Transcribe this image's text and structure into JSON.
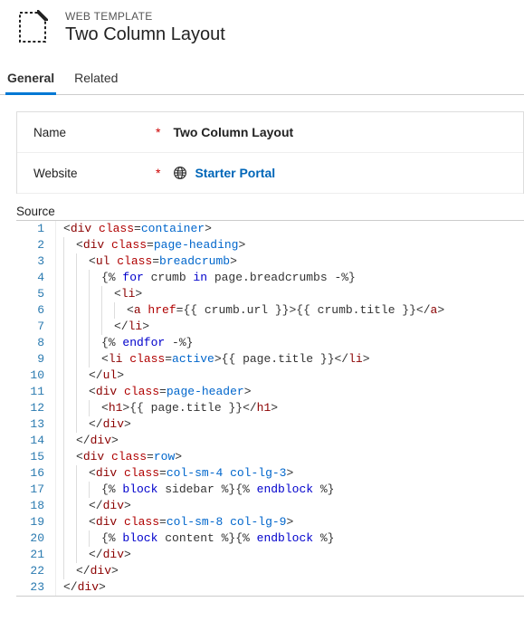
{
  "header": {
    "eyebrow": "WEB TEMPLATE",
    "title": "Two Column Layout"
  },
  "tabs": {
    "general": "General",
    "related": "Related"
  },
  "form": {
    "name_label": "Name",
    "name_value": "Two Column Layout",
    "website_label": "Website",
    "website_value": "Starter Portal",
    "source_label": "Source",
    "required_mark": "*"
  },
  "code": {
    "lines": [
      {
        "n": 1,
        "indent": 0,
        "tokens": [
          [
            "punc",
            "<"
          ],
          [
            "tag",
            "div "
          ],
          [
            "attr",
            "class"
          ],
          [
            "punc",
            "="
          ],
          [
            "val",
            "container"
          ],
          [
            "punc",
            ">"
          ]
        ]
      },
      {
        "n": 2,
        "indent": 1,
        "tokens": [
          [
            "punc",
            "<"
          ],
          [
            "tag",
            "div "
          ],
          [
            "attr",
            "class"
          ],
          [
            "punc",
            "="
          ],
          [
            "val",
            "page-heading"
          ],
          [
            "punc",
            ">"
          ]
        ]
      },
      {
        "n": 3,
        "indent": 2,
        "tokens": [
          [
            "punc",
            "<"
          ],
          [
            "tag",
            "ul "
          ],
          [
            "attr",
            "class"
          ],
          [
            "punc",
            "="
          ],
          [
            "val",
            "breadcrumb"
          ],
          [
            "punc",
            ">"
          ]
        ]
      },
      {
        "n": 4,
        "indent": 3,
        "tokens": [
          [
            "delim",
            "{% "
          ],
          [
            "kw",
            "for"
          ],
          [
            "text",
            " crumb "
          ],
          [
            "kw",
            "in"
          ],
          [
            "text",
            " page.breadcrumbs -%}"
          ]
        ]
      },
      {
        "n": 5,
        "indent": 4,
        "tokens": [
          [
            "punc",
            "<"
          ],
          [
            "tag",
            "li"
          ],
          [
            "punc",
            ">"
          ]
        ]
      },
      {
        "n": 6,
        "indent": 5,
        "tokens": [
          [
            "punc",
            "<"
          ],
          [
            "tag",
            "a "
          ],
          [
            "attr",
            "href"
          ],
          [
            "punc",
            "="
          ],
          [
            "text",
            "{{ crumb.url }}>{{ crumb.title }}"
          ],
          [
            "punc",
            "</"
          ],
          [
            "tag",
            "a"
          ],
          [
            "punc",
            ">"
          ]
        ]
      },
      {
        "n": 7,
        "indent": 4,
        "tokens": [
          [
            "punc",
            "</"
          ],
          [
            "tag",
            "li"
          ],
          [
            "punc",
            ">"
          ]
        ]
      },
      {
        "n": 8,
        "indent": 3,
        "tokens": [
          [
            "delim",
            "{% "
          ],
          [
            "kw",
            "endfor"
          ],
          [
            "text",
            " -%}"
          ]
        ]
      },
      {
        "n": 9,
        "indent": 3,
        "tokens": [
          [
            "punc",
            "<"
          ],
          [
            "tag",
            "li "
          ],
          [
            "attr",
            "class"
          ],
          [
            "punc",
            "="
          ],
          [
            "val",
            "active"
          ],
          [
            "punc",
            ">"
          ],
          [
            "text",
            "{{ page.title }}"
          ],
          [
            "punc",
            "</"
          ],
          [
            "tag",
            "li"
          ],
          [
            "punc",
            ">"
          ]
        ]
      },
      {
        "n": 10,
        "indent": 2,
        "tokens": [
          [
            "punc",
            "</"
          ],
          [
            "tag",
            "ul"
          ],
          [
            "punc",
            ">"
          ]
        ]
      },
      {
        "n": 11,
        "indent": 2,
        "tokens": [
          [
            "punc",
            "<"
          ],
          [
            "tag",
            "div "
          ],
          [
            "attr",
            "class"
          ],
          [
            "punc",
            "="
          ],
          [
            "val",
            "page-header"
          ],
          [
            "punc",
            ">"
          ]
        ]
      },
      {
        "n": 12,
        "indent": 3,
        "tokens": [
          [
            "punc",
            "<"
          ],
          [
            "tag",
            "h1"
          ],
          [
            "punc",
            ">"
          ],
          [
            "text",
            "{{ page.title }}"
          ],
          [
            "punc",
            "</"
          ],
          [
            "tag",
            "h1"
          ],
          [
            "punc",
            ">"
          ]
        ]
      },
      {
        "n": 13,
        "indent": 2,
        "tokens": [
          [
            "punc",
            "</"
          ],
          [
            "tag",
            "div"
          ],
          [
            "punc",
            ">"
          ]
        ]
      },
      {
        "n": 14,
        "indent": 1,
        "tokens": [
          [
            "punc",
            "</"
          ],
          [
            "tag",
            "div"
          ],
          [
            "punc",
            ">"
          ]
        ]
      },
      {
        "n": 15,
        "indent": 1,
        "tokens": [
          [
            "punc",
            "<"
          ],
          [
            "tag",
            "div "
          ],
          [
            "attr",
            "class"
          ],
          [
            "punc",
            "="
          ],
          [
            "val",
            "row"
          ],
          [
            "punc",
            ">"
          ]
        ]
      },
      {
        "n": 16,
        "indent": 2,
        "tokens": [
          [
            "punc",
            "<"
          ],
          [
            "tag",
            "div "
          ],
          [
            "attr",
            "class"
          ],
          [
            "punc",
            "="
          ],
          [
            "val",
            "col-sm-4 col-lg-3"
          ],
          [
            "punc",
            ">"
          ]
        ]
      },
      {
        "n": 17,
        "indent": 3,
        "tokens": [
          [
            "delim",
            "{% "
          ],
          [
            "kw",
            "block"
          ],
          [
            "text",
            " sidebar %}{% "
          ],
          [
            "kw",
            "endblock"
          ],
          [
            "text",
            " %}"
          ]
        ]
      },
      {
        "n": 18,
        "indent": 2,
        "tokens": [
          [
            "punc",
            "</"
          ],
          [
            "tag",
            "div"
          ],
          [
            "punc",
            ">"
          ]
        ]
      },
      {
        "n": 19,
        "indent": 2,
        "tokens": [
          [
            "punc",
            "<"
          ],
          [
            "tag",
            "div "
          ],
          [
            "attr",
            "class"
          ],
          [
            "punc",
            "="
          ],
          [
            "val",
            "col-sm-8 col-lg-9"
          ],
          [
            "punc",
            ">"
          ]
        ]
      },
      {
        "n": 20,
        "indent": 3,
        "tokens": [
          [
            "delim",
            "{% "
          ],
          [
            "kw",
            "block"
          ],
          [
            "text",
            " content %}{% "
          ],
          [
            "kw",
            "endblock"
          ],
          [
            "text",
            " %}"
          ]
        ]
      },
      {
        "n": 21,
        "indent": 2,
        "tokens": [
          [
            "punc",
            "</"
          ],
          [
            "tag",
            "div"
          ],
          [
            "punc",
            ">"
          ]
        ]
      },
      {
        "n": 22,
        "indent": 1,
        "tokens": [
          [
            "punc",
            "</"
          ],
          [
            "tag",
            "div"
          ],
          [
            "punc",
            ">"
          ]
        ]
      },
      {
        "n": 23,
        "indent": 0,
        "tokens": [
          [
            "punc",
            "</"
          ],
          [
            "tag",
            "div"
          ],
          [
            "punc",
            ">"
          ]
        ]
      }
    ]
  }
}
